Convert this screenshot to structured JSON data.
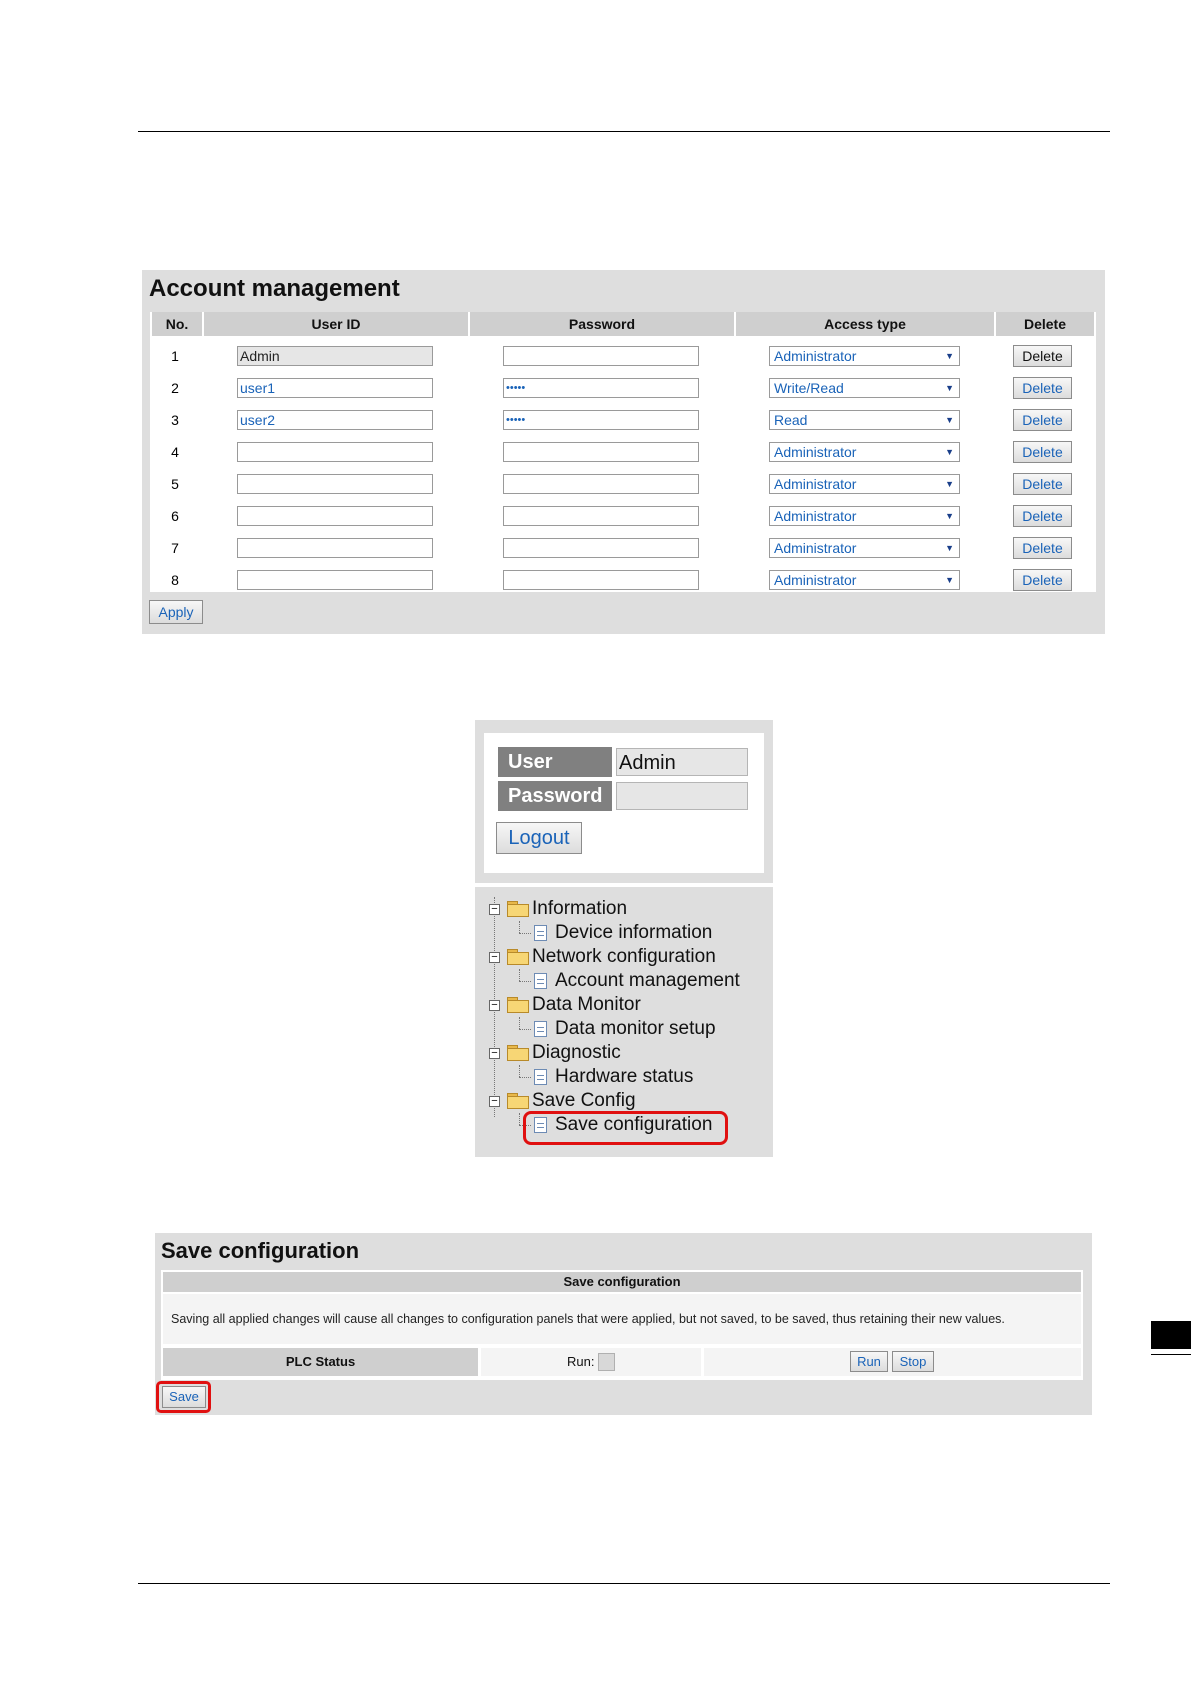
{
  "account_management": {
    "title": "Account management",
    "columns": [
      "No.",
      "User ID",
      "Password",
      "Access type",
      "Delete"
    ],
    "rows": [
      {
        "no": "1",
        "user_id": "Admin",
        "password": "",
        "access": "Administrator",
        "delete": "Delete"
      },
      {
        "no": "2",
        "user_id": "user1",
        "password": "•••••",
        "access": "Write/Read",
        "delete": "Delete"
      },
      {
        "no": "3",
        "user_id": "user2",
        "password": "•••••",
        "access": "Read",
        "delete": "Delete"
      },
      {
        "no": "4",
        "user_id": "",
        "password": "",
        "access": "Administrator",
        "delete": "Delete"
      },
      {
        "no": "5",
        "user_id": "",
        "password": "",
        "access": "Administrator",
        "delete": "Delete"
      },
      {
        "no": "6",
        "user_id": "",
        "password": "",
        "access": "Administrator",
        "delete": "Delete"
      },
      {
        "no": "7",
        "user_id": "",
        "password": "",
        "access": "Administrator",
        "delete": "Delete"
      },
      {
        "no": "8",
        "user_id": "",
        "password": "",
        "access": "Administrator",
        "delete": "Delete"
      }
    ],
    "apply_label": "Apply"
  },
  "login": {
    "user_label": "User",
    "user_value": "Admin",
    "password_label": "Password",
    "password_value": "",
    "logout_label": "Logout"
  },
  "tree": {
    "items": [
      {
        "label": "Information",
        "type": "folder"
      },
      {
        "label": "Device information",
        "type": "page"
      },
      {
        "label": "Network configuration",
        "type": "folder"
      },
      {
        "label": "Account management",
        "type": "page"
      },
      {
        "label": "Data Monitor",
        "type": "folder"
      },
      {
        "label": "Data monitor setup",
        "type": "page"
      },
      {
        "label": "Diagnostic",
        "type": "folder"
      },
      {
        "label": "Hardware status",
        "type": "page"
      },
      {
        "label": "Save Config",
        "type": "folder"
      },
      {
        "label": "Save configuration",
        "type": "page",
        "highlighted": true
      }
    ],
    "highlight_color": "#e01010"
  },
  "save_config": {
    "title": "Save configuration",
    "section_header": "Save configuration",
    "description": "Saving all applied changes will cause all changes to configuration panels that were applied, but not saved, to be saved, thus retaining their new values.",
    "plc_status_label": "PLC Status",
    "run_label": "Run:",
    "run_button": "Run",
    "stop_button": "Stop",
    "save_button": "Save"
  },
  "colors": {
    "panel_bg": "#dedede",
    "header_bg": "#cfcfcf",
    "link_blue": "#1a63b8",
    "highlight_red": "#e01010"
  }
}
